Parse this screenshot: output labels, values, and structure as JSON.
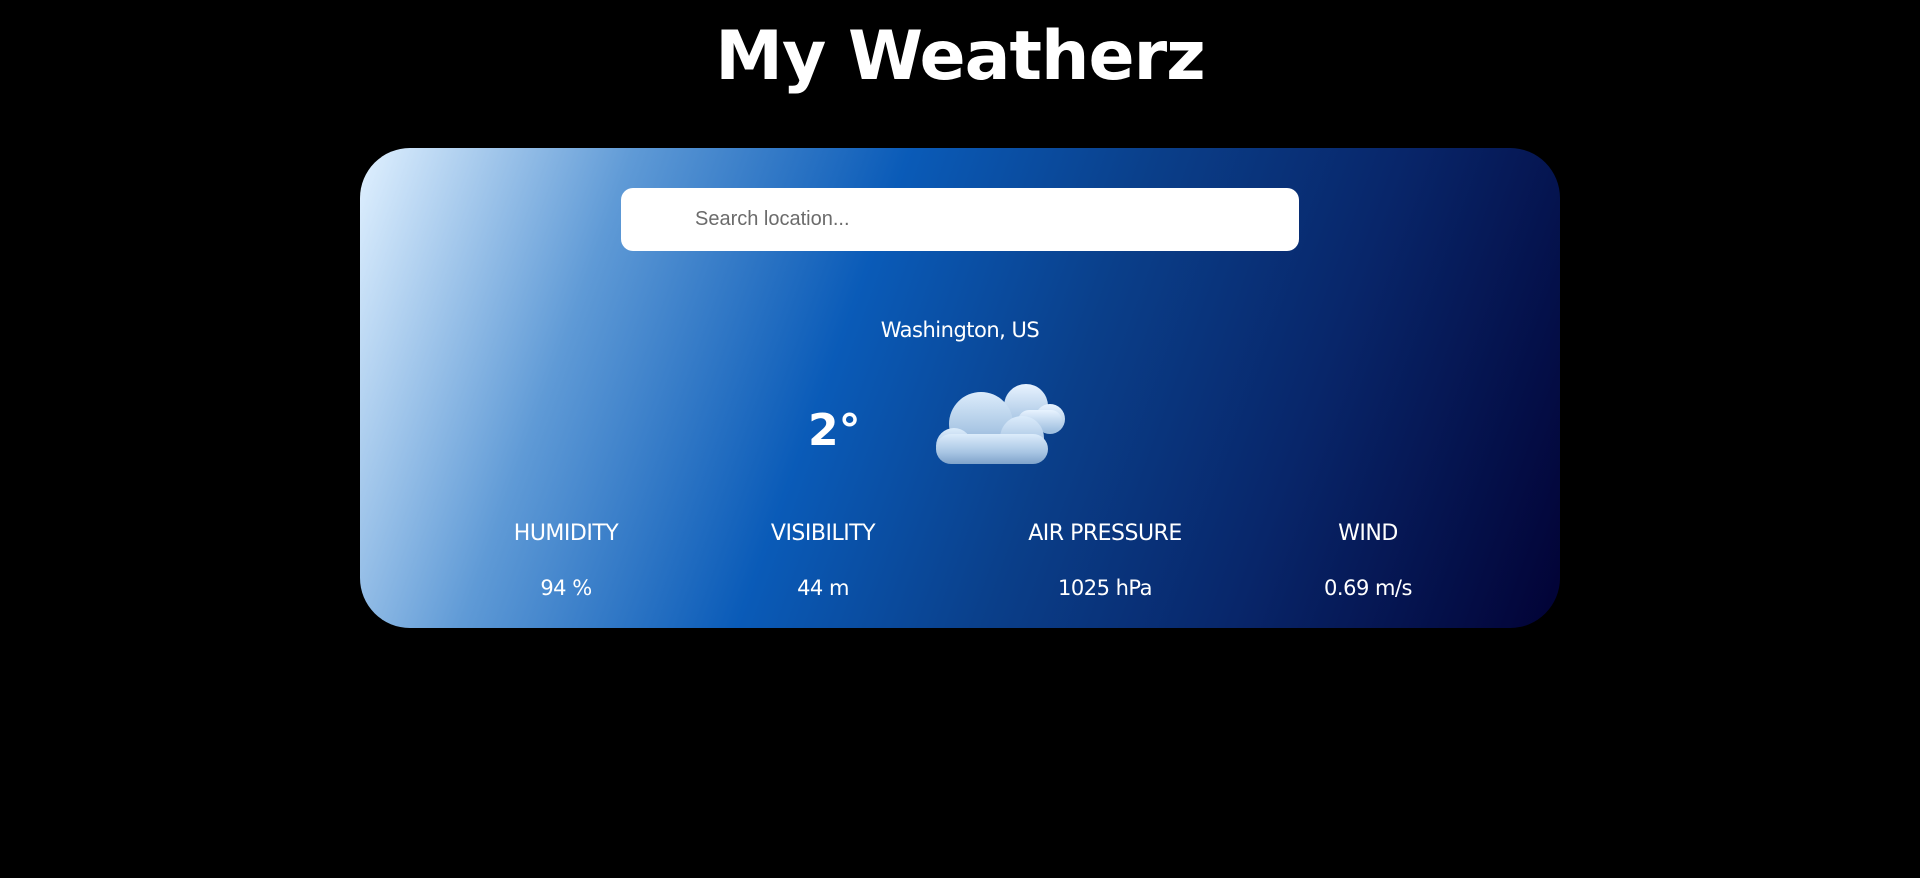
{
  "app": {
    "title": "My Weatherz"
  },
  "search": {
    "placeholder": "Search location...",
    "value": ""
  },
  "weather": {
    "location": "Washington, US",
    "temperature": "2°",
    "icon": "cloudy-icon"
  },
  "stats": [
    {
      "label": "HUMIDITY",
      "value": "94 %"
    },
    {
      "label": "VISIBILITY",
      "value": "44 m"
    },
    {
      "label": "AIR PRESSURE",
      "value": "1025 hPa"
    },
    {
      "label": "WIND",
      "value": "0.69 m/s"
    }
  ],
  "colors": {
    "page_background": "#000000",
    "text": "#ffffff",
    "gradient_start": "#e1f1ff",
    "gradient_mid": "#0a5bb8",
    "gradient_end": "#020235"
  }
}
